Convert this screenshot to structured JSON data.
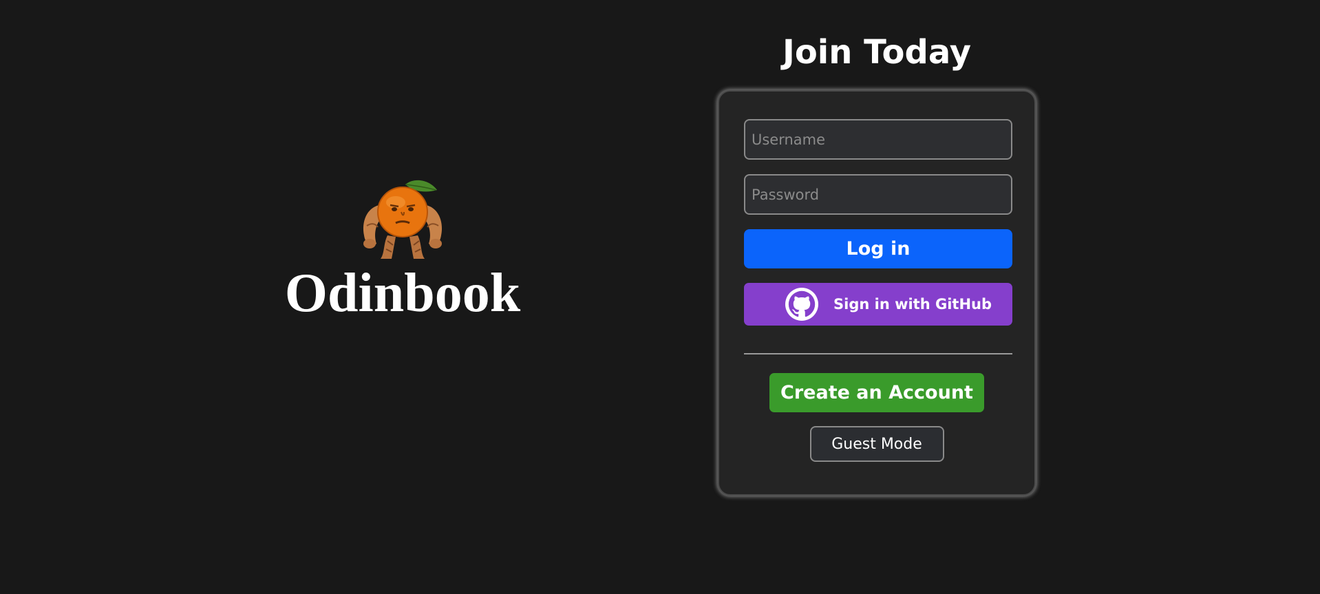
{
  "brand": {
    "title": "Odinbook",
    "logo_icon": "muscular-orange-logo"
  },
  "auth": {
    "heading": "Join Today",
    "username_placeholder": "Username",
    "password_placeholder": "Password",
    "login_label": "Log in",
    "github_label": "Sign in with GitHub",
    "github_icon": "github-icon",
    "create_account_label": "Create an Account",
    "guest_label": "Guest Mode"
  },
  "colors": {
    "background": "#181818",
    "card": "#242424",
    "login": "#0b64fb",
    "github": "#853fcc",
    "create": "#3a9b2b"
  }
}
